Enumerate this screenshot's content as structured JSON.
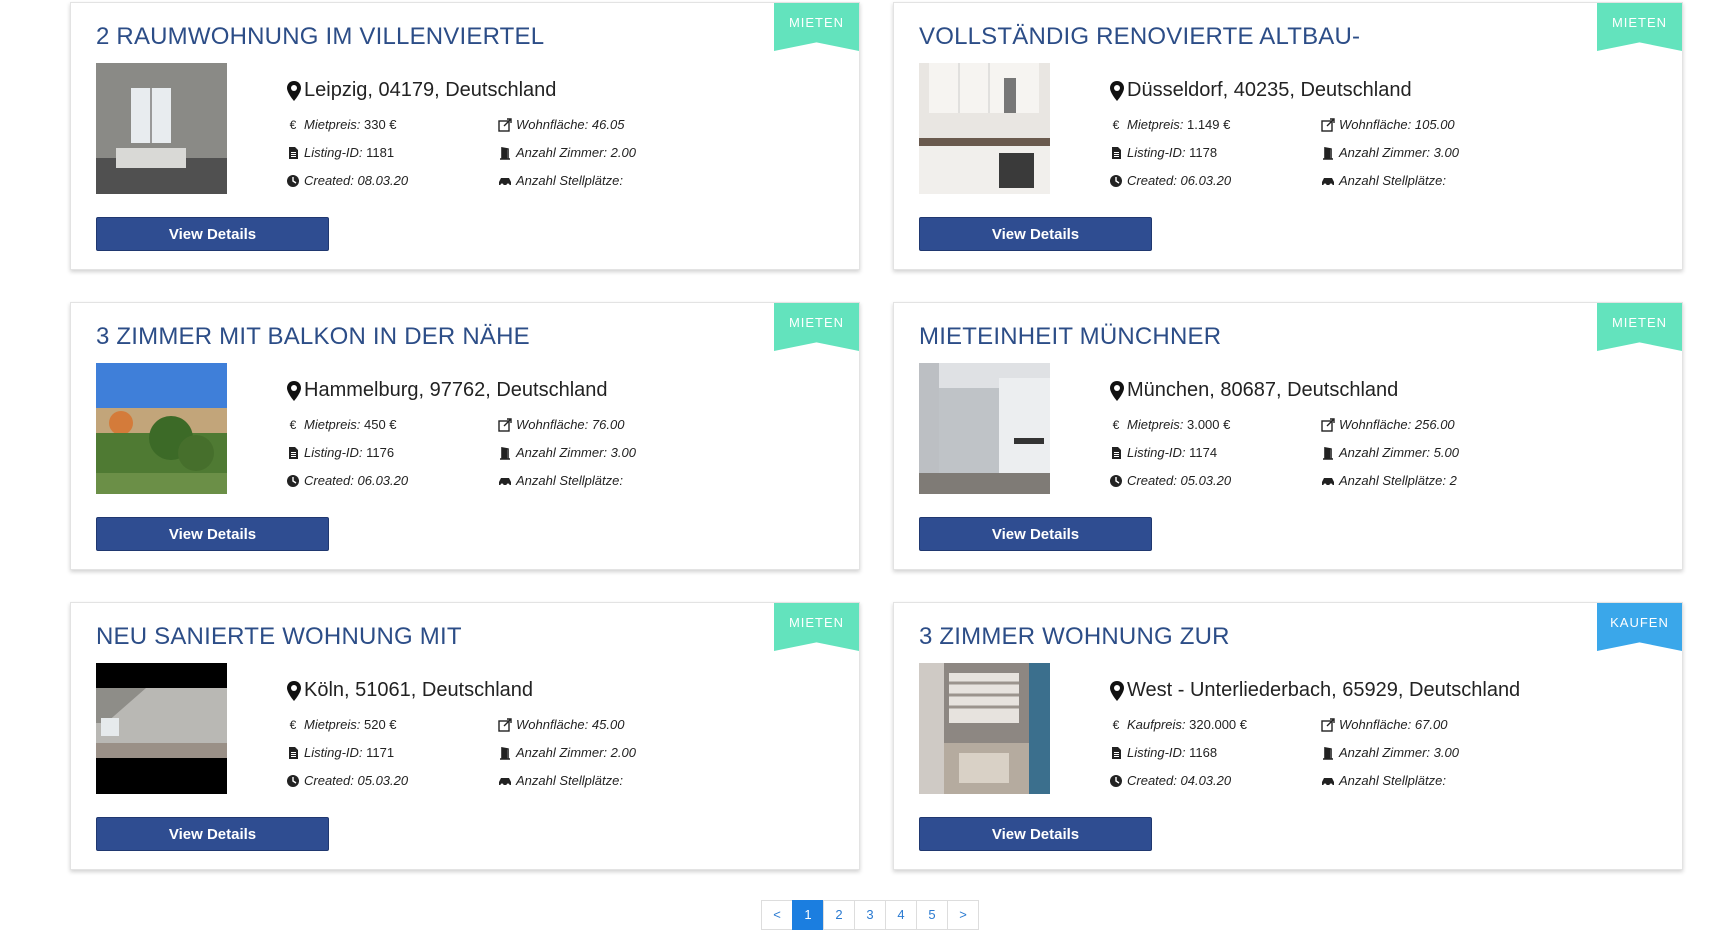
{
  "listings": [
    {
      "title": "2 Raumwohnung im Villenviertel",
      "badge": "MIETEN",
      "location": "Leipzig, 04179, Deutschland",
      "price_label": "Mietpreis:",
      "price": "330 €",
      "area_label": "Wohnfläche:",
      "area": "46.05",
      "id_label": "Listing-ID:",
      "id": "1181",
      "rooms_label": "Anzahl Zimmer:",
      "rooms": "2.00",
      "created_label": "Created:",
      "created": "08.03.20",
      "parking_label": "Anzahl Stellplätze:",
      "parking": "",
      "button": "View Details"
    },
    {
      "title": "Vollständig renovierte Altbau-",
      "badge": "MIETEN",
      "location": "Düsseldorf, 40235, Deutschland",
      "price_label": "Mietpreis:",
      "price": "1.149 €",
      "area_label": "Wohnfläche:",
      "area": "105.00",
      "id_label": "Listing-ID:",
      "id": "1178",
      "rooms_label": "Anzahl Zimmer:",
      "rooms": "3.00",
      "created_label": "Created:",
      "created": "06.03.20",
      "parking_label": "Anzahl Stellplätze:",
      "parking": "",
      "button": "View Details"
    },
    {
      "title": "3 Zimmer mit Balkon in der Nähe",
      "badge": "MIETEN",
      "location": "Hammelburg, 97762, Deutschland",
      "price_label": "Mietpreis:",
      "price": "450 €",
      "area_label": "Wohnfläche:",
      "area": "76.00",
      "id_label": "Listing-ID:",
      "id": "1176",
      "rooms_label": "Anzahl Zimmer:",
      "rooms": "3.00",
      "created_label": "Created:",
      "created": "06.03.20",
      "parking_label": "Anzahl Stellplätze:",
      "parking": "",
      "button": "View Details"
    },
    {
      "title": "Mieteinheit Münchner",
      "badge": "MIETEN",
      "location": "München, 80687, Deutschland",
      "price_label": "Mietpreis:",
      "price": "3.000 €",
      "area_label": "Wohnfläche:",
      "area": "256.00",
      "id_label": "Listing-ID:",
      "id": "1174",
      "rooms_label": "Anzahl Zimmer:",
      "rooms": "5.00",
      "created_label": "Created:",
      "created": "05.03.20",
      "parking_label": "Anzahl Stellplätze:",
      "parking": "2",
      "button": "View Details"
    },
    {
      "title": "Neu sanierte Wohnung mit",
      "badge": "MIETEN",
      "location": "Köln, 51061, Deutschland",
      "price_label": "Mietpreis:",
      "price": "520 €",
      "area_label": "Wohnfläche:",
      "area": "45.00",
      "id_label": "Listing-ID:",
      "id": "1171",
      "rooms_label": "Anzahl Zimmer:",
      "rooms": "2.00",
      "created_label": "Created:",
      "created": "05.03.20",
      "parking_label": "Anzahl Stellplätze:",
      "parking": "",
      "button": "View Details"
    },
    {
      "title": "3 Zimmer Wohnung zur",
      "badge": "KAUFEN",
      "location": "West - Unterliederbach, 65929, Deutschland",
      "price_label": "Kaufpreis:",
      "price": "320.000 €",
      "area_label": "Wohnfläche:",
      "area": "67.00",
      "id_label": "Listing-ID:",
      "id": "1168",
      "rooms_label": "Anzahl Zimmer:",
      "rooms": "3.00",
      "created_label": "Created:",
      "created": "04.03.20",
      "parking_label": "Anzahl Stellplätze:",
      "parking": "",
      "button": "View Details"
    }
  ],
  "pagination": {
    "prev": "<",
    "pages": [
      "1",
      "2",
      "3",
      "4",
      "5"
    ],
    "next": ">",
    "active": "1"
  },
  "colors": {
    "title": "#2c4d87",
    "button": "#2f4d91",
    "badge_mieten": "#63e3bd",
    "badge_kaufen": "#3aa7ea",
    "page_active": "#1b7ee0"
  }
}
